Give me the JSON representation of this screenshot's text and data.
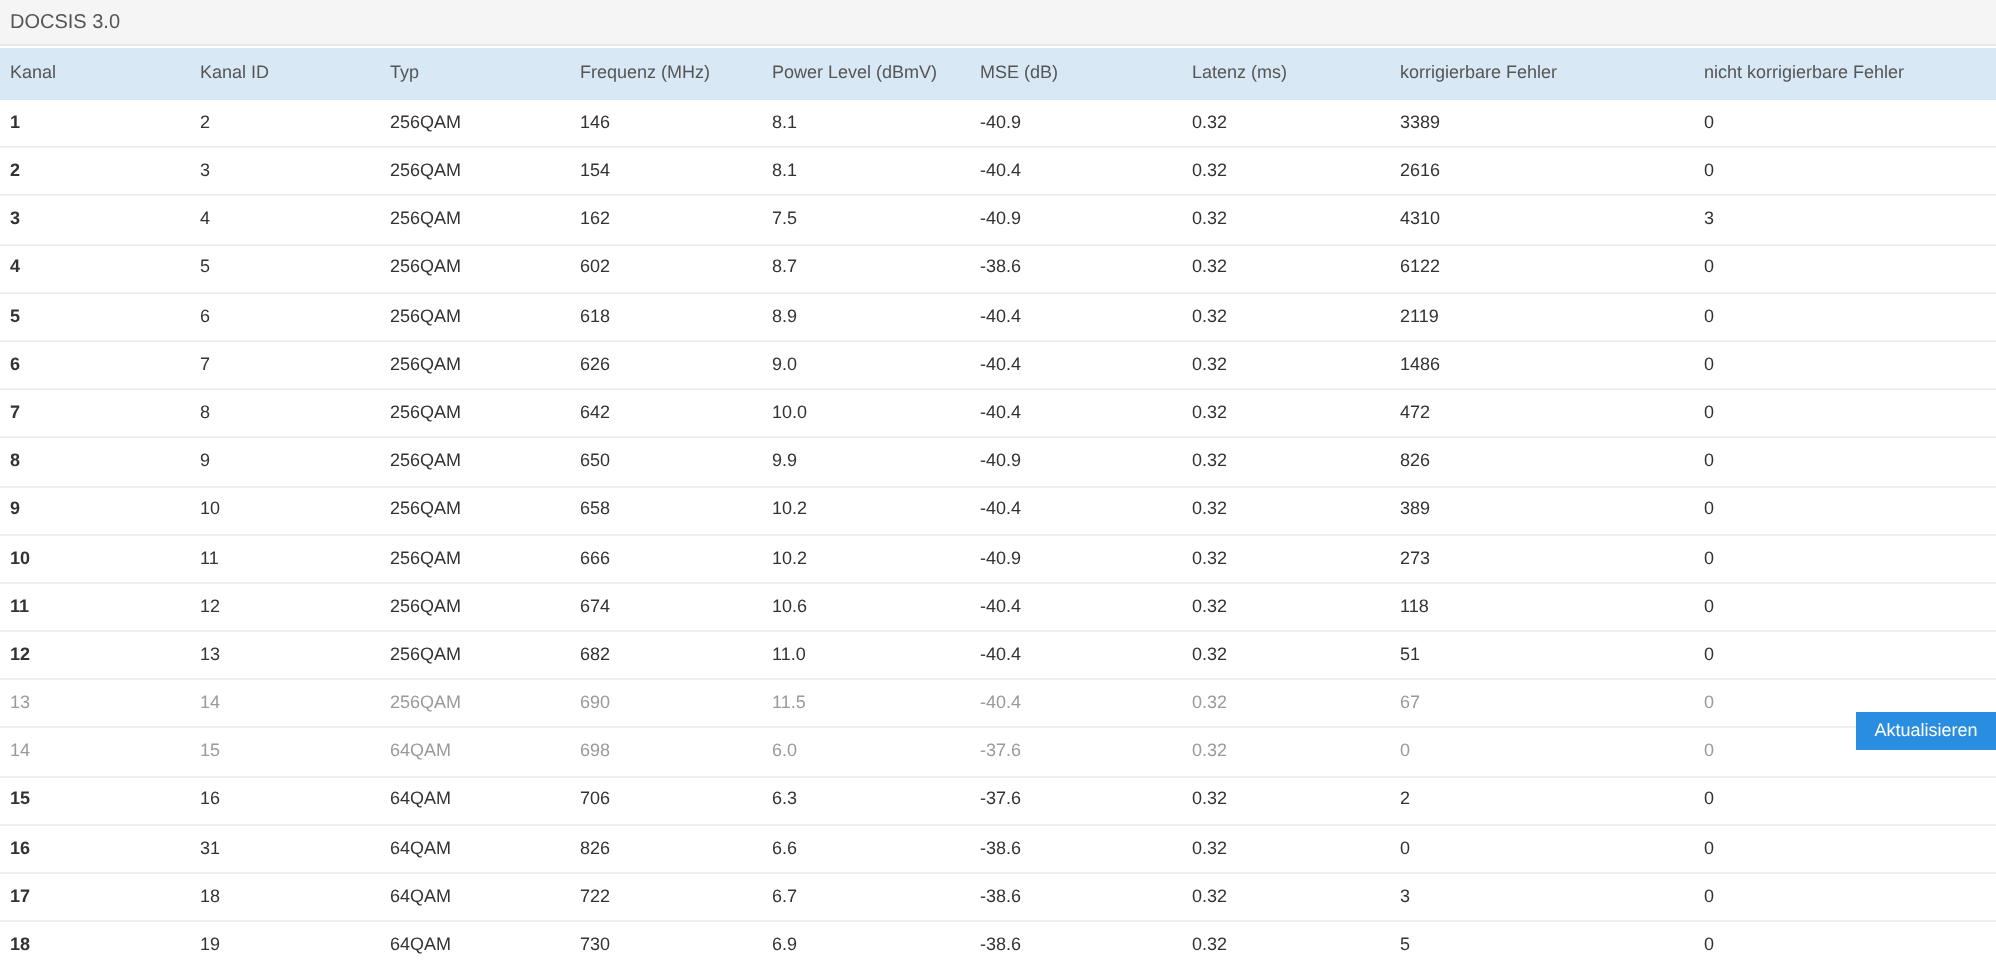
{
  "title": "DOCSIS 3.0",
  "columns": [
    "Kanal",
    "Kanal ID",
    "Typ",
    "Frequenz (MHz)",
    "Power Level (dBmV)",
    "MSE (dB)",
    "Latenz (ms)",
    "korrigierbare Fehler",
    "nicht korrigierbare Fehler"
  ],
  "rows": [
    {
      "faded": false,
      "cells": [
        "1",
        "2",
        "256QAM",
        "146",
        "8.1",
        "-40.9",
        "0.32",
        "3389",
        "0"
      ]
    },
    {
      "faded": false,
      "cells": [
        "2",
        "3",
        "256QAM",
        "154",
        "8.1",
        "-40.4",
        "0.32",
        "2616",
        "0"
      ]
    },
    {
      "faded": false,
      "cells": [
        "3",
        "4",
        "256QAM",
        "162",
        "7.5",
        "-40.9",
        "0.32",
        "4310",
        "3"
      ]
    },
    {
      "faded": false,
      "cells": [
        "4",
        "5",
        "256QAM",
        "602",
        "8.7",
        "-38.6",
        "0.32",
        "6122",
        "0"
      ]
    },
    {
      "faded": false,
      "cells": [
        "5",
        "6",
        "256QAM",
        "618",
        "8.9",
        "-40.4",
        "0.32",
        "2119",
        "0"
      ]
    },
    {
      "faded": false,
      "cells": [
        "6",
        "7",
        "256QAM",
        "626",
        "9.0",
        "-40.4",
        "0.32",
        "1486",
        "0"
      ]
    },
    {
      "faded": false,
      "cells": [
        "7",
        "8",
        "256QAM",
        "642",
        "10.0",
        "-40.4",
        "0.32",
        "472",
        "0"
      ]
    },
    {
      "faded": false,
      "cells": [
        "8",
        "9",
        "256QAM",
        "650",
        "9.9",
        "-40.9",
        "0.32",
        "826",
        "0"
      ]
    },
    {
      "faded": false,
      "cells": [
        "9",
        "10",
        "256QAM",
        "658",
        "10.2",
        "-40.4",
        "0.32",
        "389",
        "0"
      ]
    },
    {
      "faded": false,
      "cells": [
        "10",
        "11",
        "256QAM",
        "666",
        "10.2",
        "-40.9",
        "0.32",
        "273",
        "0"
      ]
    },
    {
      "faded": false,
      "cells": [
        "11",
        "12",
        "256QAM",
        "674",
        "10.6",
        "-40.4",
        "0.32",
        "118",
        "0"
      ]
    },
    {
      "faded": false,
      "cells": [
        "12",
        "13",
        "256QAM",
        "682",
        "11.0",
        "-40.4",
        "0.32",
        "51",
        "0"
      ]
    },
    {
      "faded": true,
      "cells": [
        "13",
        "14",
        "256QAM",
        "690",
        "11.5",
        "-40.4",
        "0.32",
        "67",
        "0"
      ]
    },
    {
      "faded": true,
      "cells": [
        "14",
        "15",
        "64QAM",
        "698",
        "6.0",
        "-37.6",
        "0.32",
        "0",
        "0"
      ]
    },
    {
      "faded": false,
      "cells": [
        "15",
        "16",
        "64QAM",
        "706",
        "6.3",
        "-37.6",
        "0.32",
        "2",
        "0"
      ]
    },
    {
      "faded": false,
      "cells": [
        "16",
        "31",
        "64QAM",
        "826",
        "6.6",
        "-38.6",
        "0.32",
        "0",
        "0"
      ]
    },
    {
      "faded": false,
      "cells": [
        "17",
        "18",
        "64QAM",
        "722",
        "6.7",
        "-38.6",
        "0.32",
        "3",
        "0"
      ]
    },
    {
      "faded": false,
      "cells": [
        "18",
        "19",
        "64QAM",
        "730",
        "6.9",
        "-38.6",
        "0.32",
        "5",
        "0"
      ]
    }
  ],
  "button": "Aktualisieren"
}
